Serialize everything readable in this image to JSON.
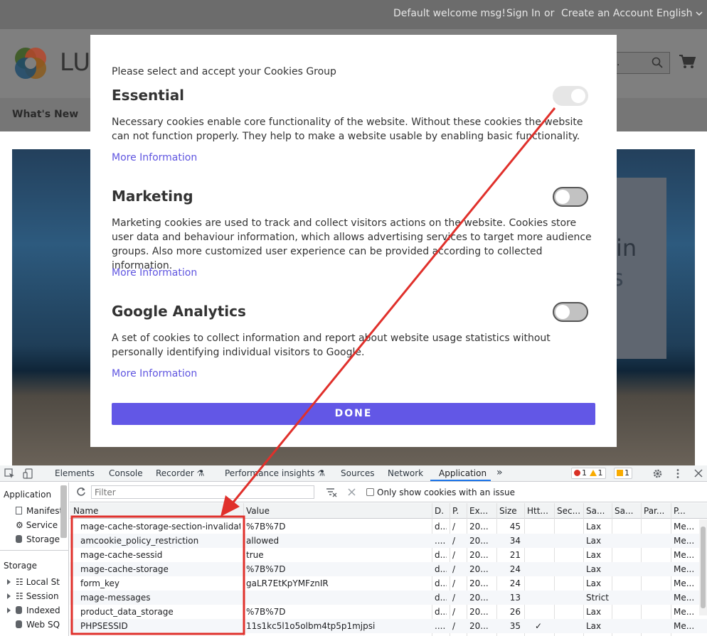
{
  "store": {
    "welcome": "Default welcome msg!",
    "sign_in": "Sign In",
    "or": "or",
    "create_account": "Create an Account",
    "language": "English",
    "logo_text": "LU",
    "search_text": "re...",
    "nav_whats_new": "What's New",
    "hero_text_1": "in",
    "hero_text_2": "s"
  },
  "modal": {
    "intro": "Please select and accept your Cookies Group",
    "groups": [
      {
        "title": "Essential",
        "description": "Necessary cookies enable core functionality of the website. Without these cookies the website can not function properly. They help to make a website usable by enabling basic functionality.",
        "link": "More Information",
        "enabled": true,
        "disabled": true
      },
      {
        "title": "Marketing",
        "description": "Marketing cookies are used to track and collect visitors actions on the website. Cookies store user data and behaviour information, which allows advertising services to target more audience groups. Also more customized user experience can be provided according to collected information.",
        "link": "More Information",
        "enabled": false,
        "disabled": false
      },
      {
        "title": "Google Analytics",
        "description": "A set of cookies to collect information and report about website usage statistics without personally identifying individual visitors to Google.",
        "link": "More Information",
        "enabled": false,
        "disabled": false
      }
    ],
    "done_label": "DONE",
    "accent": "#6257e6",
    "link_color": "#5f55e0"
  },
  "devtools": {
    "tabs": [
      "Elements",
      "Console",
      "Recorder",
      "Performance insights",
      "Sources",
      "Network",
      "Application"
    ],
    "active_tab": "Application",
    "badges": {
      "errors": "1",
      "warnings": "1",
      "issues": "1"
    },
    "sidebar": {
      "application_heading": "Application",
      "application_items": [
        "Manifest",
        "Service",
        "Storage"
      ],
      "storage_heading": "Storage",
      "storage_items": [
        "Local St",
        "Session",
        "Indexed",
        "Web SQ"
      ]
    },
    "filter_placeholder": "Filter",
    "only_issue_label": "Only show cookies with an issue",
    "columns": [
      "Name",
      "Value",
      "D.",
      "P.",
      "Ex...",
      "Size",
      "Htt...",
      "Sec...",
      "Sa...",
      "Sa...",
      "Par...",
      "P..."
    ],
    "cookies": [
      {
        "name": "mage-cache-storage-section-invalidation",
        "value": "%7B%7D",
        "domain": "d...",
        "path": "/",
        "expires": "20...",
        "size": "45",
        "http": "",
        "secure": "",
        "samesite": "Lax",
        "priority": "Me..."
      },
      {
        "name": "amcookie_policy_restriction",
        "value": "allowed",
        "domain": "....",
        "path": "/",
        "expires": "20...",
        "size": "34",
        "http": "",
        "secure": "",
        "samesite": "Lax",
        "priority": "Me..."
      },
      {
        "name": "mage-cache-sessid",
        "value": "true",
        "domain": "d...",
        "path": "/",
        "expires": "20...",
        "size": "21",
        "http": "",
        "secure": "",
        "samesite": "Lax",
        "priority": "Me..."
      },
      {
        "name": "mage-cache-storage",
        "value": "%7B%7D",
        "domain": "d...",
        "path": "/",
        "expires": "20...",
        "size": "24",
        "http": "",
        "secure": "",
        "samesite": "Lax",
        "priority": "Me..."
      },
      {
        "name": "form_key",
        "value": "gaLR7EtKpYMFznIR",
        "domain": "d...",
        "path": "/",
        "expires": "20...",
        "size": "24",
        "http": "",
        "secure": "",
        "samesite": "Lax",
        "priority": "Me..."
      },
      {
        "name": "mage-messages",
        "value": "",
        "domain": "d...",
        "path": "/",
        "expires": "20...",
        "size": "13",
        "http": "",
        "secure": "",
        "samesite": "Strict",
        "priority": "Me..."
      },
      {
        "name": "product_data_storage",
        "value": "%7B%7D",
        "domain": "d...",
        "path": "/",
        "expires": "20...",
        "size": "26",
        "http": "",
        "secure": "",
        "samesite": "Lax",
        "priority": "Me..."
      },
      {
        "name": "PHPSESSID",
        "value": "11s1kc5l1o5olbm4tp5p1mjpsi",
        "domain": "....",
        "path": "/",
        "expires": "20...",
        "size": "35",
        "http": "✓",
        "secure": "",
        "samesite": "Lax",
        "priority": "Me..."
      }
    ]
  },
  "annotation": {
    "color": "#e0302b"
  }
}
